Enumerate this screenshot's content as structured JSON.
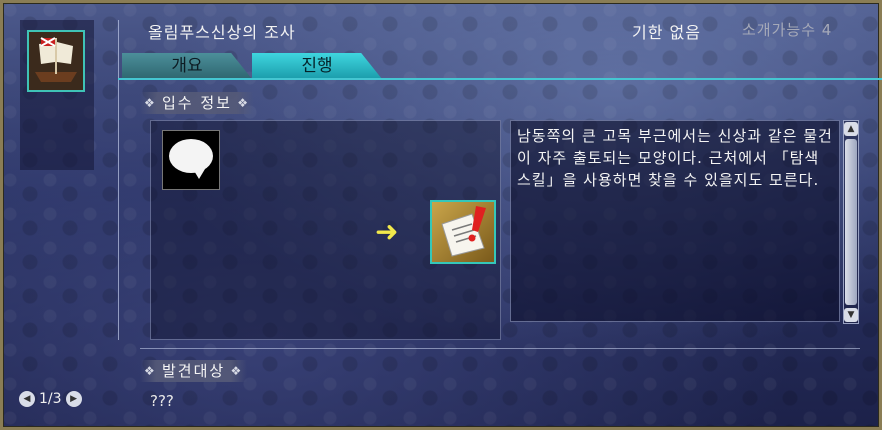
{
  "quest": {
    "title": "올림푸스신상의 조사",
    "deadline": "기한 없음",
    "intro_count": "소개가능수 4"
  },
  "tabs": [
    {
      "label": "개요",
      "active": false
    },
    {
      "label": "진행",
      "active": true
    }
  ],
  "sections": {
    "acquire_label": "입수 정보",
    "discovery_label": "발견대상"
  },
  "description": "남동쪽의 큰 고목 부근에서는 신상과 같은 물건이 자주 출토되는 모양이다. 근처에서 「탐색 스킬」을 사용하면 찾을 수 있을지도 모른다.",
  "discovery_target": "???",
  "pager": {
    "text": "1/3"
  },
  "icons": {
    "ship": "sailing-ship-icon",
    "speech": "speech-bubble-icon",
    "arrow": "right-arrow-icon",
    "document": "document-exclamation-icon"
  },
  "colors": {
    "accent_teal": "#3fd6df",
    "arrow_yellow": "#f2e94b",
    "frame_gold": "#8a7d55"
  }
}
